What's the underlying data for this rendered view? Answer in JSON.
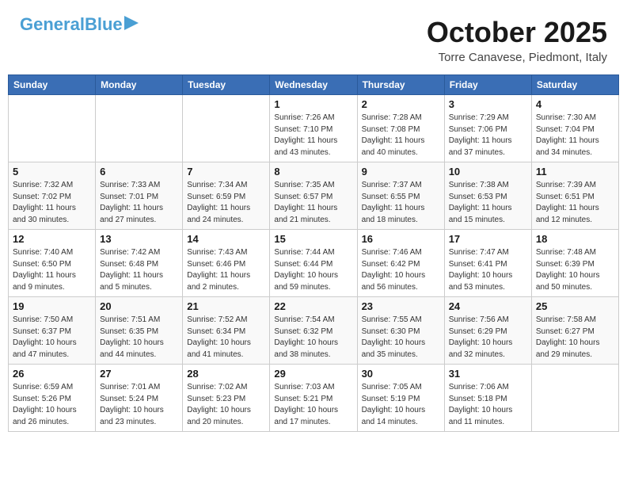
{
  "header": {
    "logo_line1": "General",
    "logo_line2": "Blue",
    "month_title": "October 2025",
    "location": "Torre Canavese, Piedmont, Italy"
  },
  "weekdays": [
    "Sunday",
    "Monday",
    "Tuesday",
    "Wednesday",
    "Thursday",
    "Friday",
    "Saturday"
  ],
  "weeks": [
    [
      {
        "day": "",
        "sunrise": "",
        "sunset": "",
        "daylight": ""
      },
      {
        "day": "",
        "sunrise": "",
        "sunset": "",
        "daylight": ""
      },
      {
        "day": "",
        "sunrise": "",
        "sunset": "",
        "daylight": ""
      },
      {
        "day": "1",
        "sunrise": "Sunrise: 7:26 AM",
        "sunset": "Sunset: 7:10 PM",
        "daylight": "Daylight: 11 hours and 43 minutes."
      },
      {
        "day": "2",
        "sunrise": "Sunrise: 7:28 AM",
        "sunset": "Sunset: 7:08 PM",
        "daylight": "Daylight: 11 hours and 40 minutes."
      },
      {
        "day": "3",
        "sunrise": "Sunrise: 7:29 AM",
        "sunset": "Sunset: 7:06 PM",
        "daylight": "Daylight: 11 hours and 37 minutes."
      },
      {
        "day": "4",
        "sunrise": "Sunrise: 7:30 AM",
        "sunset": "Sunset: 7:04 PM",
        "daylight": "Daylight: 11 hours and 34 minutes."
      }
    ],
    [
      {
        "day": "5",
        "sunrise": "Sunrise: 7:32 AM",
        "sunset": "Sunset: 7:02 PM",
        "daylight": "Daylight: 11 hours and 30 minutes."
      },
      {
        "day": "6",
        "sunrise": "Sunrise: 7:33 AM",
        "sunset": "Sunset: 7:01 PM",
        "daylight": "Daylight: 11 hours and 27 minutes."
      },
      {
        "day": "7",
        "sunrise": "Sunrise: 7:34 AM",
        "sunset": "Sunset: 6:59 PM",
        "daylight": "Daylight: 11 hours and 24 minutes."
      },
      {
        "day": "8",
        "sunrise": "Sunrise: 7:35 AM",
        "sunset": "Sunset: 6:57 PM",
        "daylight": "Daylight: 11 hours and 21 minutes."
      },
      {
        "day": "9",
        "sunrise": "Sunrise: 7:37 AM",
        "sunset": "Sunset: 6:55 PM",
        "daylight": "Daylight: 11 hours and 18 minutes."
      },
      {
        "day": "10",
        "sunrise": "Sunrise: 7:38 AM",
        "sunset": "Sunset: 6:53 PM",
        "daylight": "Daylight: 11 hours and 15 minutes."
      },
      {
        "day": "11",
        "sunrise": "Sunrise: 7:39 AM",
        "sunset": "Sunset: 6:51 PM",
        "daylight": "Daylight: 11 hours and 12 minutes."
      }
    ],
    [
      {
        "day": "12",
        "sunrise": "Sunrise: 7:40 AM",
        "sunset": "Sunset: 6:50 PM",
        "daylight": "Daylight: 11 hours and 9 minutes."
      },
      {
        "day": "13",
        "sunrise": "Sunrise: 7:42 AM",
        "sunset": "Sunset: 6:48 PM",
        "daylight": "Daylight: 11 hours and 5 minutes."
      },
      {
        "day": "14",
        "sunrise": "Sunrise: 7:43 AM",
        "sunset": "Sunset: 6:46 PM",
        "daylight": "Daylight: 11 hours and 2 minutes."
      },
      {
        "day": "15",
        "sunrise": "Sunrise: 7:44 AM",
        "sunset": "Sunset: 6:44 PM",
        "daylight": "Daylight: 10 hours and 59 minutes."
      },
      {
        "day": "16",
        "sunrise": "Sunrise: 7:46 AM",
        "sunset": "Sunset: 6:42 PM",
        "daylight": "Daylight: 10 hours and 56 minutes."
      },
      {
        "day": "17",
        "sunrise": "Sunrise: 7:47 AM",
        "sunset": "Sunset: 6:41 PM",
        "daylight": "Daylight: 10 hours and 53 minutes."
      },
      {
        "day": "18",
        "sunrise": "Sunrise: 7:48 AM",
        "sunset": "Sunset: 6:39 PM",
        "daylight": "Daylight: 10 hours and 50 minutes."
      }
    ],
    [
      {
        "day": "19",
        "sunrise": "Sunrise: 7:50 AM",
        "sunset": "Sunset: 6:37 PM",
        "daylight": "Daylight: 10 hours and 47 minutes."
      },
      {
        "day": "20",
        "sunrise": "Sunrise: 7:51 AM",
        "sunset": "Sunset: 6:35 PM",
        "daylight": "Daylight: 10 hours and 44 minutes."
      },
      {
        "day": "21",
        "sunrise": "Sunrise: 7:52 AM",
        "sunset": "Sunset: 6:34 PM",
        "daylight": "Daylight: 10 hours and 41 minutes."
      },
      {
        "day": "22",
        "sunrise": "Sunrise: 7:54 AM",
        "sunset": "Sunset: 6:32 PM",
        "daylight": "Daylight: 10 hours and 38 minutes."
      },
      {
        "day": "23",
        "sunrise": "Sunrise: 7:55 AM",
        "sunset": "Sunset: 6:30 PM",
        "daylight": "Daylight: 10 hours and 35 minutes."
      },
      {
        "day": "24",
        "sunrise": "Sunrise: 7:56 AM",
        "sunset": "Sunset: 6:29 PM",
        "daylight": "Daylight: 10 hours and 32 minutes."
      },
      {
        "day": "25",
        "sunrise": "Sunrise: 7:58 AM",
        "sunset": "Sunset: 6:27 PM",
        "daylight": "Daylight: 10 hours and 29 minutes."
      }
    ],
    [
      {
        "day": "26",
        "sunrise": "Sunrise: 6:59 AM",
        "sunset": "Sunset: 5:26 PM",
        "daylight": "Daylight: 10 hours and 26 minutes."
      },
      {
        "day": "27",
        "sunrise": "Sunrise: 7:01 AM",
        "sunset": "Sunset: 5:24 PM",
        "daylight": "Daylight: 10 hours and 23 minutes."
      },
      {
        "day": "28",
        "sunrise": "Sunrise: 7:02 AM",
        "sunset": "Sunset: 5:23 PM",
        "daylight": "Daylight: 10 hours and 20 minutes."
      },
      {
        "day": "29",
        "sunrise": "Sunrise: 7:03 AM",
        "sunset": "Sunset: 5:21 PM",
        "daylight": "Daylight: 10 hours and 17 minutes."
      },
      {
        "day": "30",
        "sunrise": "Sunrise: 7:05 AM",
        "sunset": "Sunset: 5:19 PM",
        "daylight": "Daylight: 10 hours and 14 minutes."
      },
      {
        "day": "31",
        "sunrise": "Sunrise: 7:06 AM",
        "sunset": "Sunset: 5:18 PM",
        "daylight": "Daylight: 10 hours and 11 minutes."
      },
      {
        "day": "",
        "sunrise": "",
        "sunset": "",
        "daylight": ""
      }
    ]
  ]
}
